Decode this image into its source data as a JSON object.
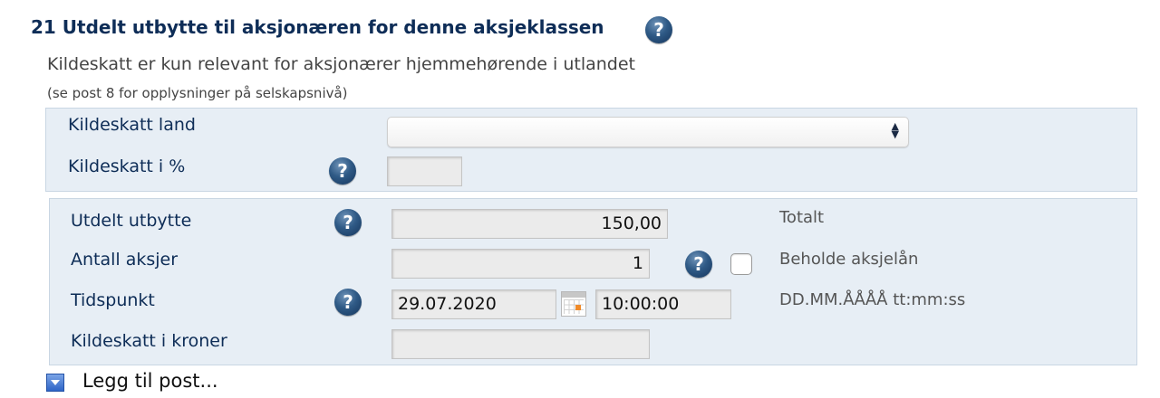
{
  "section": {
    "title": "21 Utdelt utbytte til aksjonæren for denne aksjeklassen",
    "desc_line1": "Kildeskatt er kun relevant for aksjonærer hjemmehørende i utlandet",
    "desc_line2": "(se post 8 for opplysninger på selskapsnivå)"
  },
  "help": {
    "icon_glyph": "?"
  },
  "withholding": {
    "country_label": "Kildeskatt land",
    "country_value": "",
    "percent_label": "Kildeskatt i %",
    "percent_value": ""
  },
  "dividend": {
    "amount_label": "Utdelt utbytte",
    "amount_value": "150,00",
    "total_label": "Totalt",
    "shares_label": "Antall aksjer",
    "shares_value": "1",
    "keep_loan_label": "Beholde aksjelån",
    "keep_loan_checked": false,
    "time_label": "Tidspunkt",
    "date_value": "29.07.2020",
    "time_value": "10:00:00",
    "format_hint": "DD.MM.ÅÅÅÅ tt:mm:ss",
    "tax_kroner_label": "Kildeskatt i kroner",
    "tax_kroner_value": ""
  },
  "add_post": {
    "label": "Legg til post..."
  },
  "colors": {
    "title": "#0e2d57",
    "panel_bg": "#e7eef5",
    "help_icon": "#2f5a86",
    "calendar_mark": "#f08b2a"
  }
}
